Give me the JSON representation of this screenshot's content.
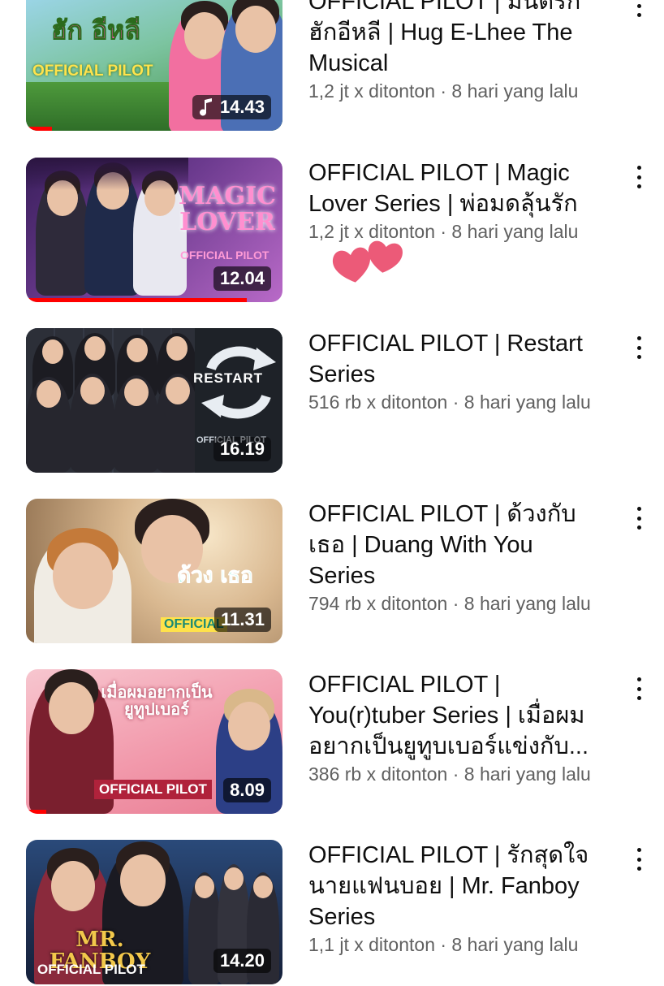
{
  "videos": [
    {
      "title": "OFFICIAL PILOT | มันดีรัก ฮักอีหลี | Hug E-Lhee The Musical",
      "line1": "OFFICIAL PILOT | มันดีรัก",
      "line2": "ฮักอีหลี | Hug E-Lhee The",
      "line3": "Musical",
      "info": "1,2 jt x ditonton · 8 hari yang lalu",
      "duration": "14.43",
      "art_title": "ฮัก อีหลี",
      "art_tag": "OFFICIAL PILOT",
      "progress": 0.1
    },
    {
      "line1": "OFFICIAL PILOT | Magic",
      "line2": "Lover Series | พ่อมดลุ้นรัก",
      "info": "1,2 jt x ditonton · 8 hari yang lalu",
      "duration": "12.04",
      "art_title": "MAGIC LOVER",
      "art_tag": "OFFICIAL PILOT",
      "progress": 0.86
    },
    {
      "line1": "OFFICIAL PILOT | Restart",
      "line2": "Series",
      "info": "516 rb x ditonton · 8 hari yang lalu",
      "duration": "16.19",
      "art_title": "RESTART",
      "art_tag": "OFFICIAL PILOT",
      "progress": 0
    },
    {
      "line1": "OFFICIAL PILOT | ด้วงกับ",
      "line2": "เธอ | Duang With You",
      "line3": "Series",
      "info": "794 rb x ditonton · 8 hari yang lalu",
      "duration": "11.31",
      "art_title": "ด้วง เธอ",
      "art_tag": "OFFICIAL",
      "progress": 0
    },
    {
      "line1": "OFFICIAL PILOT |",
      "line2": "You(r)tuber Series | เมื่อผม",
      "line3": "อยากเป็นยูทูบเบอร์แข่งกับ...",
      "info": "386 rb x ditonton · 8 hari yang lalu",
      "duration": "8.09",
      "art_title": "เมื่อผมอยากเป็น ยูทูปเบอร์",
      "art_tag": "OFFICIAL PILOT",
      "progress": 0.08
    },
    {
      "line1": "OFFICIAL PILOT | รักสุดใจ",
      "line2": "นายแฟนบอย | Mr. Fanboy",
      "line3": "Series",
      "info": "1,1 jt x ditonton · 8 hari yang lalu",
      "duration": "14.20",
      "art_title": "MR. FANBOY",
      "art_tag": "OFFICIAL PILOT",
      "progress": 0
    }
  ],
  "icons": {
    "menu": "more-vertical-icon",
    "music": "music-note-icon",
    "hearts": "hearts-sticker-icon"
  },
  "colors": {
    "progress": "#ff0000",
    "meta": "#606060",
    "text": "#0f0f0f"
  }
}
